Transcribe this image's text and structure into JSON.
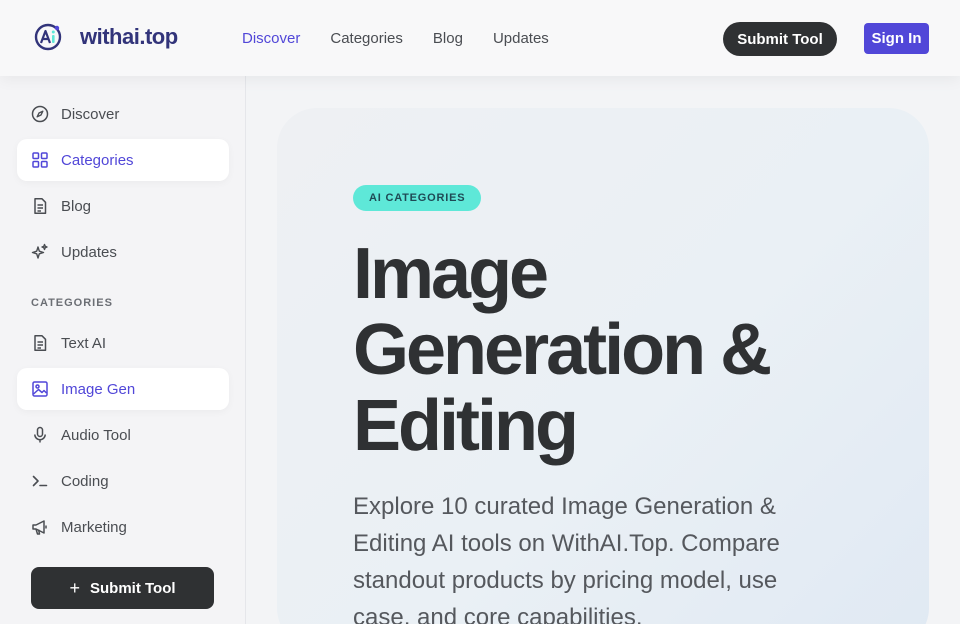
{
  "header": {
    "logo_text": "withai.top",
    "nav": [
      {
        "label": "Discover",
        "active": true
      },
      {
        "label": "Categories",
        "active": false
      },
      {
        "label": "Blog",
        "active": false
      },
      {
        "label": "Updates",
        "active": false
      }
    ],
    "submit_label": "Submit Tool",
    "signin_label": "Sign In"
  },
  "sidebar": {
    "items": [
      {
        "label": "Discover",
        "icon": "compass-icon",
        "active": false
      },
      {
        "label": "Categories",
        "icon": "grid-icon",
        "active": true
      },
      {
        "label": "Blog",
        "icon": "document-icon",
        "active": false
      },
      {
        "label": "Updates",
        "icon": "sparkles-icon",
        "active": false
      }
    ],
    "categories_heading": "CATEGORIES",
    "categories": [
      {
        "label": "Text AI",
        "icon": "file-text-icon",
        "active": false
      },
      {
        "label": "Image Gen",
        "icon": "image-icon",
        "active": true
      },
      {
        "label": "Audio Tool",
        "icon": "microphone-icon",
        "active": false
      },
      {
        "label": "Coding",
        "icon": "terminal-icon",
        "active": false
      },
      {
        "label": "Marketing",
        "icon": "megaphone-icon",
        "active": false
      }
    ],
    "submit_label": "Submit Tool"
  },
  "hero": {
    "badge": "AI CATEGORIES",
    "title": "Image Generation & Editing",
    "description": "Explore 10 curated Image Generation & Editing AI tools on WithAI.Top. Compare standout products by pricing model, use case, and core capabilities."
  },
  "colors": {
    "accent": "#5147d8",
    "dark": "#2f3133",
    "badge_bg": "#5ee8d8"
  }
}
